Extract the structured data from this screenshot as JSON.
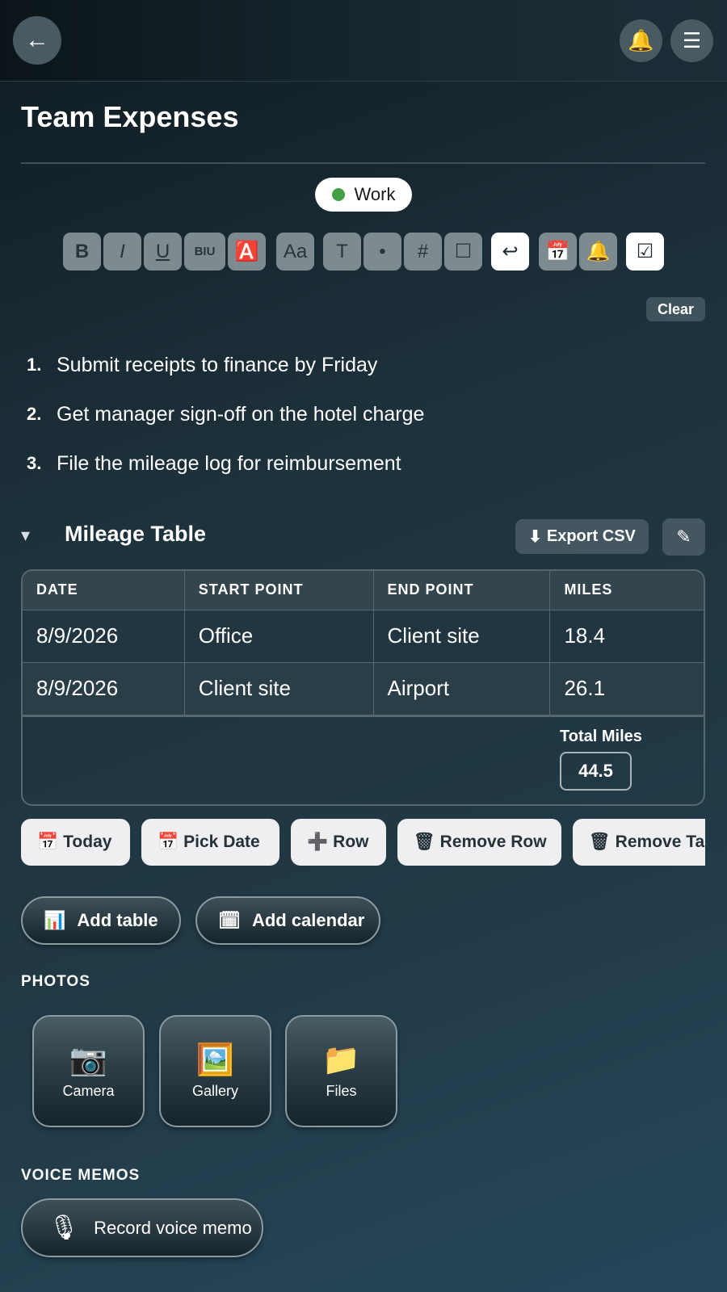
{
  "header": {
    "back_icon": "←",
    "bell_icon": "🔔",
    "menu_icon": "☰"
  },
  "title": "Team Expenses",
  "tag": {
    "label": "Work",
    "color": "#43a047"
  },
  "toolbar": {
    "bold": "B",
    "italic": "I",
    "underline": "U",
    "biu": "BIU",
    "text_color": "🅰️",
    "font_size": "Aa",
    "text_style": "T",
    "bullet": "•",
    "number": "#",
    "checkbox": "☐",
    "undo": "↩",
    "calendar": "📅",
    "reminder": "🔔",
    "checklist": "☑"
  },
  "clear_label": "Clear",
  "list": [
    {
      "num": "1.",
      "text": "Submit receipts to finance by Friday"
    },
    {
      "num": "2.",
      "text": "Get manager sign-off on the hotel charge"
    },
    {
      "num": "3.",
      "text": "File the mileage log for reimbursement"
    }
  ],
  "table_section": {
    "collapse_icon": "▾",
    "title": "Mileage Table",
    "export_icon": "⬇",
    "export_label": "Export CSV",
    "edit_icon": "✎",
    "columns": [
      "DATE",
      "START POINT",
      "END POINT",
      "MILES"
    ],
    "rows": [
      [
        "8/9/2026",
        "Office",
        "Client site",
        "18.4"
      ],
      [
        "8/9/2026",
        "Client site",
        "Airport",
        "26.1"
      ]
    ],
    "total_label": "Total Miles",
    "total_value": "44.5"
  },
  "table_actions": {
    "today": {
      "icon": "📅",
      "label": "Today"
    },
    "pick_date": {
      "icon": "📅",
      "label": "Pick Date"
    },
    "add_row": {
      "icon": "➕",
      "label": "Row"
    },
    "remove_row": {
      "icon": "🗑",
      "label": "Remove Row"
    },
    "remove_table": {
      "icon": "🗑",
      "label": "Remove Table"
    }
  },
  "add_buttons": {
    "table": {
      "icon": "📊",
      "label": "Add table"
    },
    "calendar": {
      "icon": "🗓",
      "label": "Add calendar"
    }
  },
  "photos": {
    "heading": "PHOTOS",
    "camera": {
      "icon": "📷",
      "label": "Camera"
    },
    "gallery": {
      "icon": "🖼️",
      "label": "Gallery"
    },
    "files": {
      "icon": "📁",
      "label": "Files"
    }
  },
  "voice": {
    "heading": "VOICE MEMOS",
    "icon": "🎙",
    "label": "Record voice memo"
  }
}
